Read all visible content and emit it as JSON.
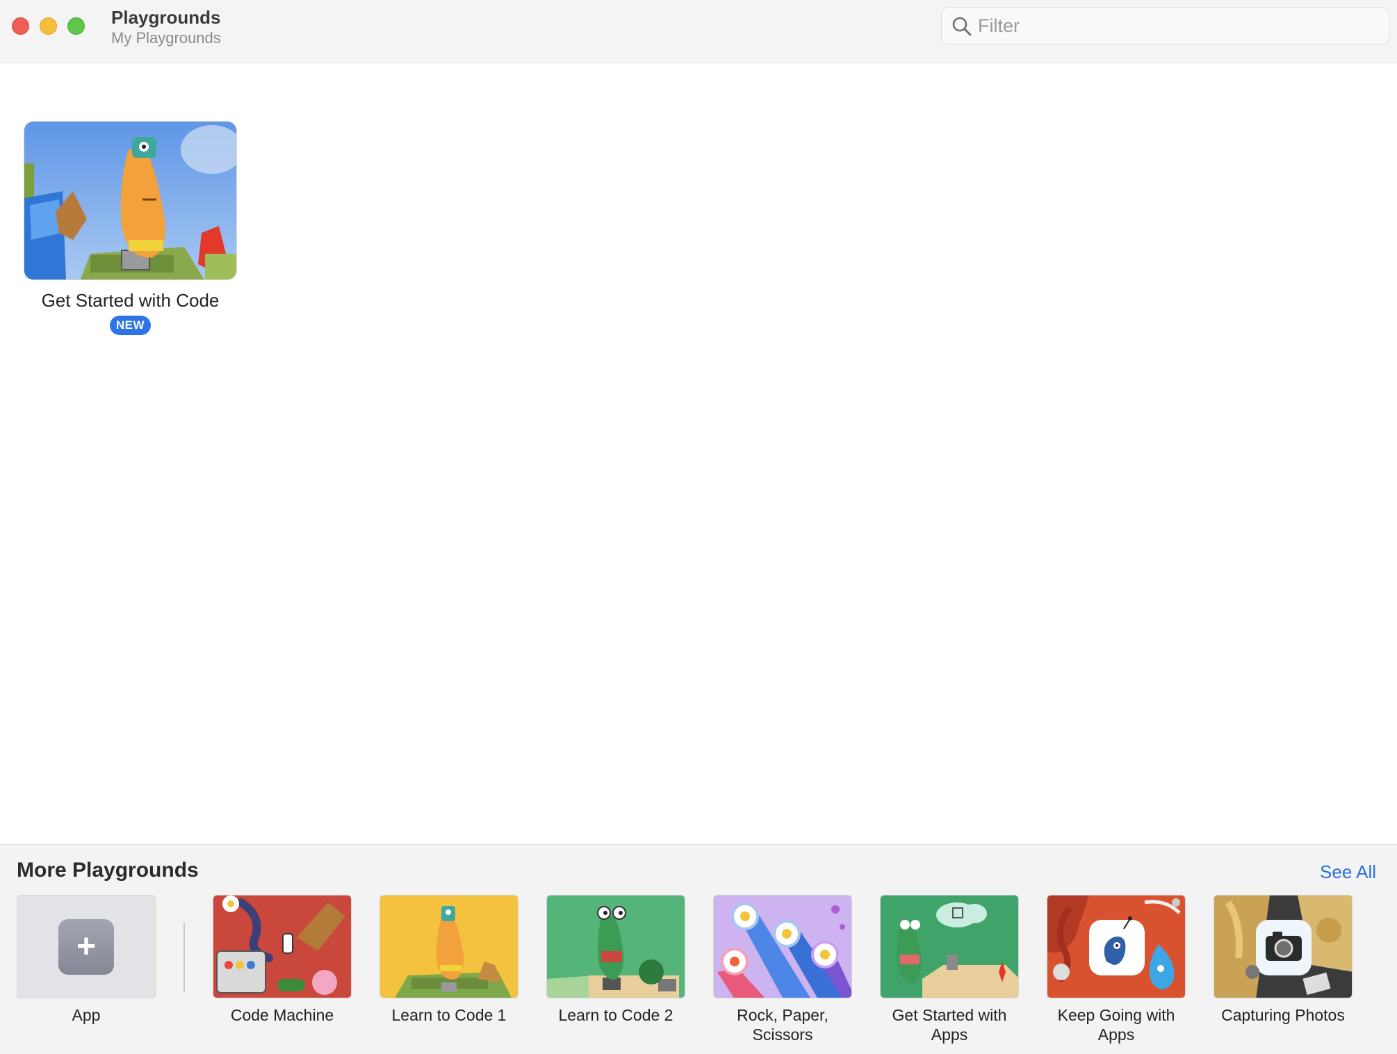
{
  "window": {
    "title": "Playgrounds",
    "subtitle": "My Playgrounds"
  },
  "search": {
    "placeholder": "Filter",
    "value": ""
  },
  "my_playgrounds": [
    {
      "name": "Get Started with Code",
      "badge": "NEW"
    }
  ],
  "more_playgrounds": {
    "title": "More Playgrounds",
    "see_all": "See All",
    "items": [
      {
        "name": "App",
        "icon": "plus-icon"
      },
      {
        "name": "Code Machine"
      },
      {
        "name": "Learn to Code 1"
      },
      {
        "name": "Learn to Code 2"
      },
      {
        "name": "Rock, Paper, Scissors"
      },
      {
        "name": "Get Started with Apps"
      },
      {
        "name": "Keep Going with Apps"
      },
      {
        "name": "Capturing Photos"
      }
    ]
  },
  "colors": {
    "accent": "#2c6fe0",
    "badge": "#2f74e6",
    "close": "#ee5d57",
    "minimize": "#f5bd3a",
    "zoom": "#5fc64a"
  }
}
